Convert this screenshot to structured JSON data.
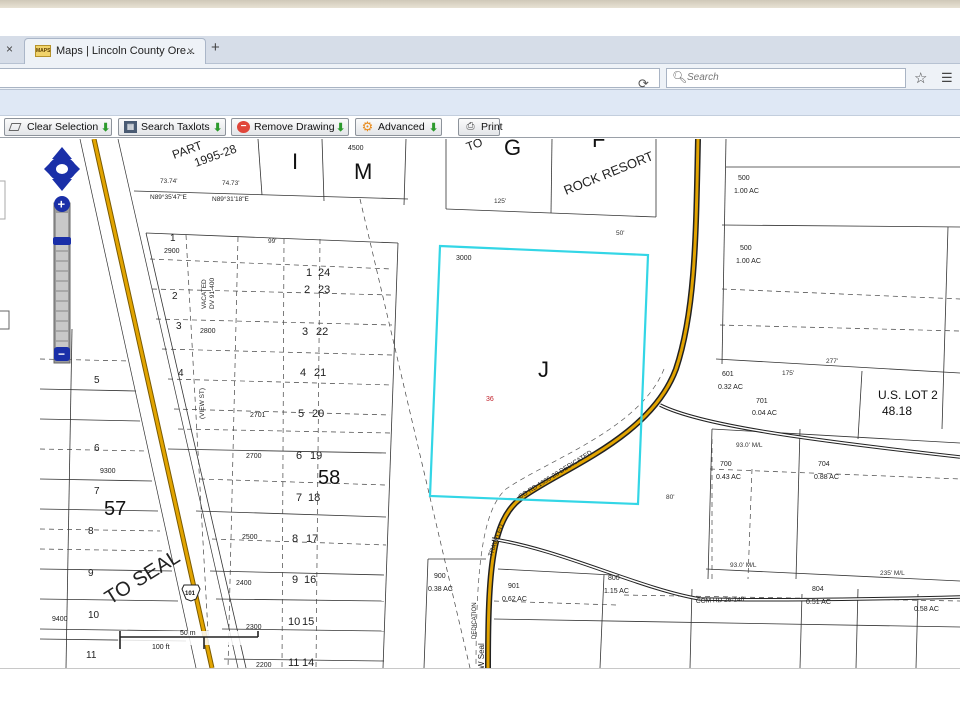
{
  "browser": {
    "tab_title": "Maps | Lincoln County Ore...",
    "tab_favicon_label": "MAPS",
    "tab_close": "×",
    "left_tab_close": "×",
    "new_tab": "+",
    "search_placeholder": "Search",
    "icons": [
      "reload-icon",
      "search-icon",
      "bookmark-star-icon",
      "reader-list-icon"
    ]
  },
  "toolbar": {
    "clear_selection": "Clear Selection",
    "search_taxlots": "Search Taxlots",
    "remove_drawing": "Remove Drawing",
    "advanced": "Advanced",
    "print": "Print"
  },
  "map": {
    "highlight_color": "#33d6e6",
    "road_color": "#e2a400",
    "labels": {
      "section_i": "I",
      "section_m": "M",
      "section_g": "G",
      "section_f": "F",
      "section_j": "J",
      "rock_resort": "ROCK RESORT",
      "parcel_1995": "1995-28",
      "part": "PART",
      "to_label": "TO",
      "to_seal": "TO SEAL",
      "highway_101": "101",
      "block_57": "57",
      "block_58": "58",
      "us_lot_2": "U.S. LOT 2",
      "us_lot_2_area": "48.18",
      "lot_3000": "3000",
      "lot_36": "36",
      "lot_4500": "4500",
      "lot_2900": "2900",
      "lot_2800": "2800",
      "lot_2701": "2701",
      "lot_2700": "2700",
      "lot_2500": "2500",
      "lot_2400": "2400",
      "lot_2300": "2300",
      "lot_2200": "2200",
      "lot_9300": "9300",
      "lot_9400": "9400",
      "lot_500a": "500",
      "lot_500a_ac": "1.00 AC",
      "lot_500b": "500",
      "lot_500b_ac": "1.00 AC",
      "lot_601": "601",
      "lot_601_ac": "0.32 AC",
      "lot_701": "701",
      "lot_701_ac": "0.04 AC",
      "lot_700": "700",
      "lot_700_ac": "0.43 AC",
      "lot_704": "704",
      "lot_704_ac": "0.88 AC",
      "lot_900": "900",
      "lot_900_ac": "0.38 AC",
      "lot_901": "901",
      "lot_901_ac": "0.62 AC",
      "lot_800": "800",
      "lot_800_ac": "1.15 AC",
      "lot_804": "804",
      "lot_804_ac": "0.51 AC",
      "lot_805_ac": "0.58 AC",
      "dim_99": "99'",
      "dim_50": "50'",
      "dim_125": "125'",
      "dim_277": "277'",
      "dim_175": "175'",
      "dim_235": "235' M/L",
      "dim_93a": "93.0' M/L",
      "dim_93b": "93.0' M/L",
      "dim_80": "80'",
      "dim_74_73": "73.74'",
      "dim_74_73b": "74.73'",
      "bearing_1": "N89°35'47\"E",
      "bearing_2": "N89°31'18\"E",
      "vacated": "VACATED",
      "vacated_ref": "DV 91-400",
      "view_st": "(VIEW ST)",
      "co_rd_label": "CO RD 1995-28 DEDICATED",
      "co_rd_num": "COM RD 26-140",
      "traveled": "TRAVELED",
      "w_seal": "W Seal",
      "dedication": "DEDICATION",
      "lot_nums_a": [
        "1",
        "2",
        "3",
        "4",
        "5",
        "6",
        "7",
        "8",
        "9",
        "10",
        "11"
      ],
      "lot_nums_b": [
        "24",
        "23",
        "22",
        "21",
        "20",
        "19",
        "18",
        "17",
        "16",
        "15",
        "14"
      ],
      "lot_nums_c": [
        "1",
        "2",
        "3",
        "4",
        "5",
        "6",
        "7",
        "8",
        "9",
        "10",
        "11"
      ]
    },
    "scale": {
      "metric": "50 m",
      "imperial": "100 ft"
    },
    "zoom": {
      "in": "+",
      "out": "−"
    }
  }
}
